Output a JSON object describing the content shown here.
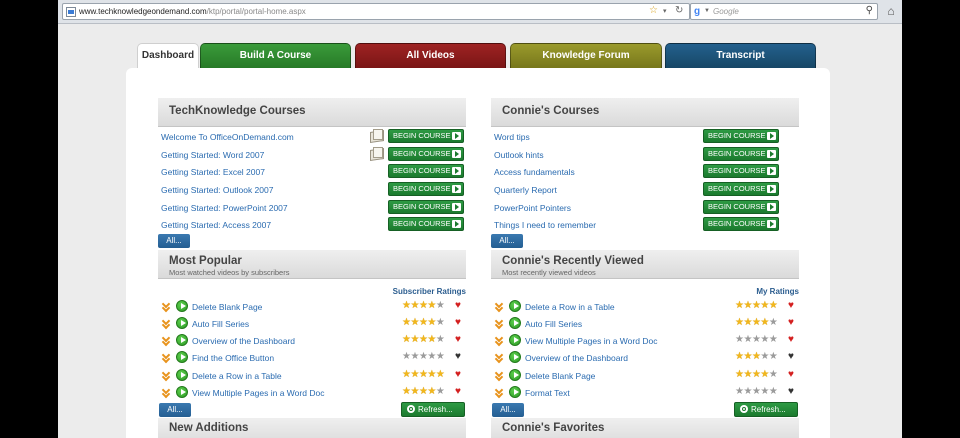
{
  "browser": {
    "url_host": "www.techknowledgeondemand.com",
    "url_path": "/ktp/portal/portal-home.aspx",
    "search_placeholder": "Google"
  },
  "tabs": [
    {
      "label": "Dashboard",
      "color": "#ffffff",
      "active": true
    },
    {
      "label": "Build A Course",
      "color": "#2f8a2f"
    },
    {
      "label": "All Videos",
      "color": "#8b1a1a"
    },
    {
      "label": "Knowledge Forum",
      "color": "#8a8a22"
    },
    {
      "label": "Transcript",
      "color": "#1b4f78"
    }
  ],
  "left": {
    "courses": {
      "title": "TechKnowledge Courses",
      "items": [
        {
          "label": "Welcome To OfficeOnDemand.com",
          "button": "BEGIN COURSE",
          "book": true
        },
        {
          "label": "Getting Started: Word 2007",
          "button": "BEGIN COURSE",
          "book": true
        },
        {
          "label": "Getting Started: Excel 2007",
          "button": "BEGIN COURSE"
        },
        {
          "label": "Getting Started: Outlook 2007",
          "button": "BEGIN COURSE"
        },
        {
          "label": "Getting Started: PowerPoint 2007",
          "button": "BEGIN COURSE"
        },
        {
          "label": "Getting Started: Access 2007",
          "button": "BEGIN COURSE"
        }
      ],
      "all_label": "All..."
    },
    "popular": {
      "title": "Most Popular",
      "subtitle": "Most watched videos by subscribers",
      "ratings_label": "Subscriber Ratings",
      "items": [
        {
          "label": "Delete Blank Page",
          "stars": 4,
          "heart": "#d42020"
        },
        {
          "label": "Auto Fill Series",
          "stars": 4,
          "heart": "#d42020"
        },
        {
          "label": "Overview of the Dashboard",
          "stars": 4,
          "heart": "#d42020"
        },
        {
          "label": "Find the Office Button",
          "stars": 0,
          "heart": "#333333"
        },
        {
          "label": "Delete a Row in a Table",
          "stars": 5,
          "heart": "#d42020"
        },
        {
          "label": "View Multiple Pages in a Word Doc",
          "stars": 4,
          "heart": "#d42020"
        }
      ],
      "all_label": "All...",
      "refresh_label": "Refresh..."
    },
    "additions": {
      "title": "New Additions"
    }
  },
  "right": {
    "courses": {
      "title": "Connie's Courses",
      "items": [
        {
          "label": "Word tips",
          "button": "BEGIN COURSE"
        },
        {
          "label": "Outlook hints",
          "button": "BEGIN COURSE"
        },
        {
          "label": "Access fundamentals",
          "button": "BEGIN COURSE"
        },
        {
          "label": "Quarterly Report",
          "button": "BEGIN COURSE"
        },
        {
          "label": "PowerPoint Pointers",
          "button": "BEGIN COURSE"
        },
        {
          "label": "Things I need to remember",
          "button": "BEGIN COURSE"
        }
      ],
      "all_label": "All..."
    },
    "recent": {
      "title": "Connie's Recently Viewed",
      "subtitle": "Most recently viewed videos",
      "ratings_label": "My Ratings",
      "items": [
        {
          "label": "Delete a Row in a Table",
          "stars": 5,
          "heart": "#d42020"
        },
        {
          "label": "Auto Fill Series",
          "stars": 4,
          "heart": "#d42020"
        },
        {
          "label": "View Multiple Pages in a Word Doc",
          "stars": 0,
          "heart": "#d42020"
        },
        {
          "label": "Overview of the Dashboard",
          "stars": 3,
          "heart": "#333333"
        },
        {
          "label": "Delete Blank Page",
          "stars": 4,
          "heart": "#d42020"
        },
        {
          "label": "Format Text",
          "stars": 0,
          "heart": "#333333"
        }
      ],
      "all_label": "All...",
      "refresh_label": "Refresh..."
    },
    "favorites": {
      "title": "Connie's Favorites"
    }
  }
}
